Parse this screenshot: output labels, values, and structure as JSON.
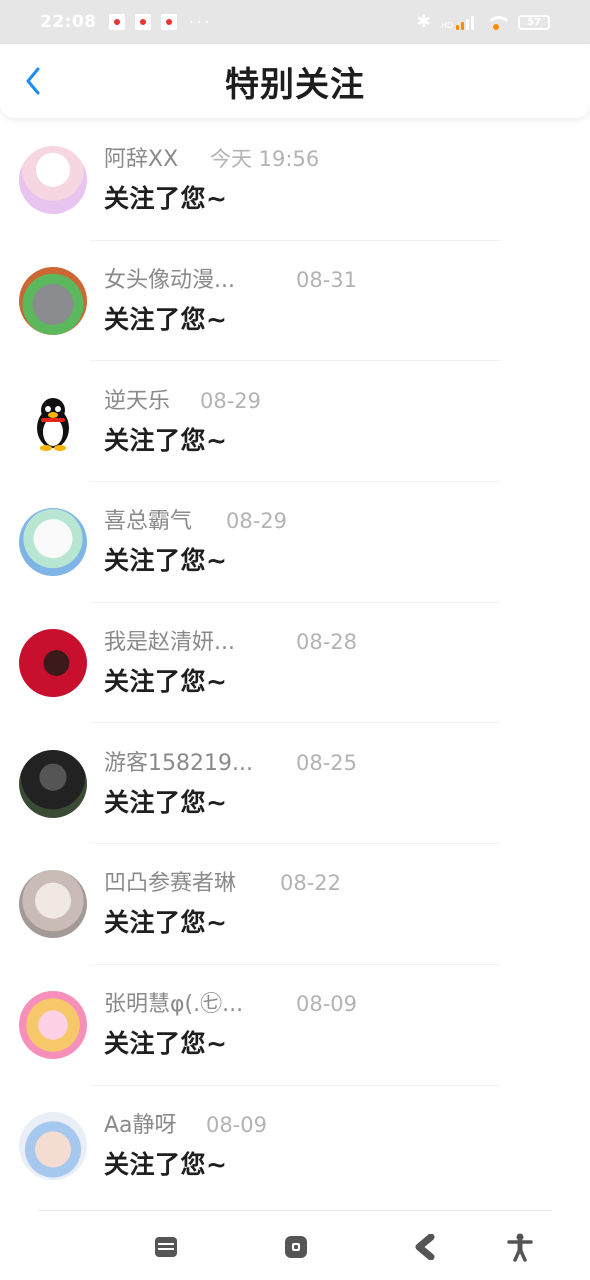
{
  "status_bar": {
    "time": "22:08",
    "dots": "···",
    "bluetooth": "✱",
    "network_tag": "HD",
    "battery": "57",
    "icons": [
      "notification-icon",
      "notification-icon",
      "notification-icon",
      "bluetooth-icon",
      "signal-icon",
      "wifi-icon",
      "battery-icon"
    ]
  },
  "header": {
    "title": "特别关注",
    "back_icon": "chevron-left-icon",
    "accent": "#1a8cff"
  },
  "items": [
    {
      "name": "阿辞XX",
      "time": "今天 19:56",
      "message": "关注了您~"
    },
    {
      "name": "女头像动漫...",
      "time": "08-31",
      "message": "关注了您~"
    },
    {
      "name": "逆天乐",
      "time": "08-29",
      "message": "关注了您~"
    },
    {
      "name": "喜总霸气",
      "time": "08-29",
      "message": "关注了您~"
    },
    {
      "name": "我是赵清妍...",
      "time": "08-28",
      "message": "关注了您~"
    },
    {
      "name": "游客158219...",
      "time": "08-25",
      "message": "关注了您~"
    },
    {
      "name": "凹凸参赛者琳",
      "time": "08-22",
      "message": "关注了您~"
    },
    {
      "name": "张明慧φ(.㊆...",
      "time": "08-09",
      "message": "关注了您~"
    },
    {
      "name": "Aa静呀",
      "time": "08-09",
      "message": "关注了您~"
    }
  ],
  "nav": {
    "icons": [
      "menu-icon",
      "home-icon",
      "back-icon",
      "accessibility-icon"
    ],
    "color": "#555555"
  }
}
